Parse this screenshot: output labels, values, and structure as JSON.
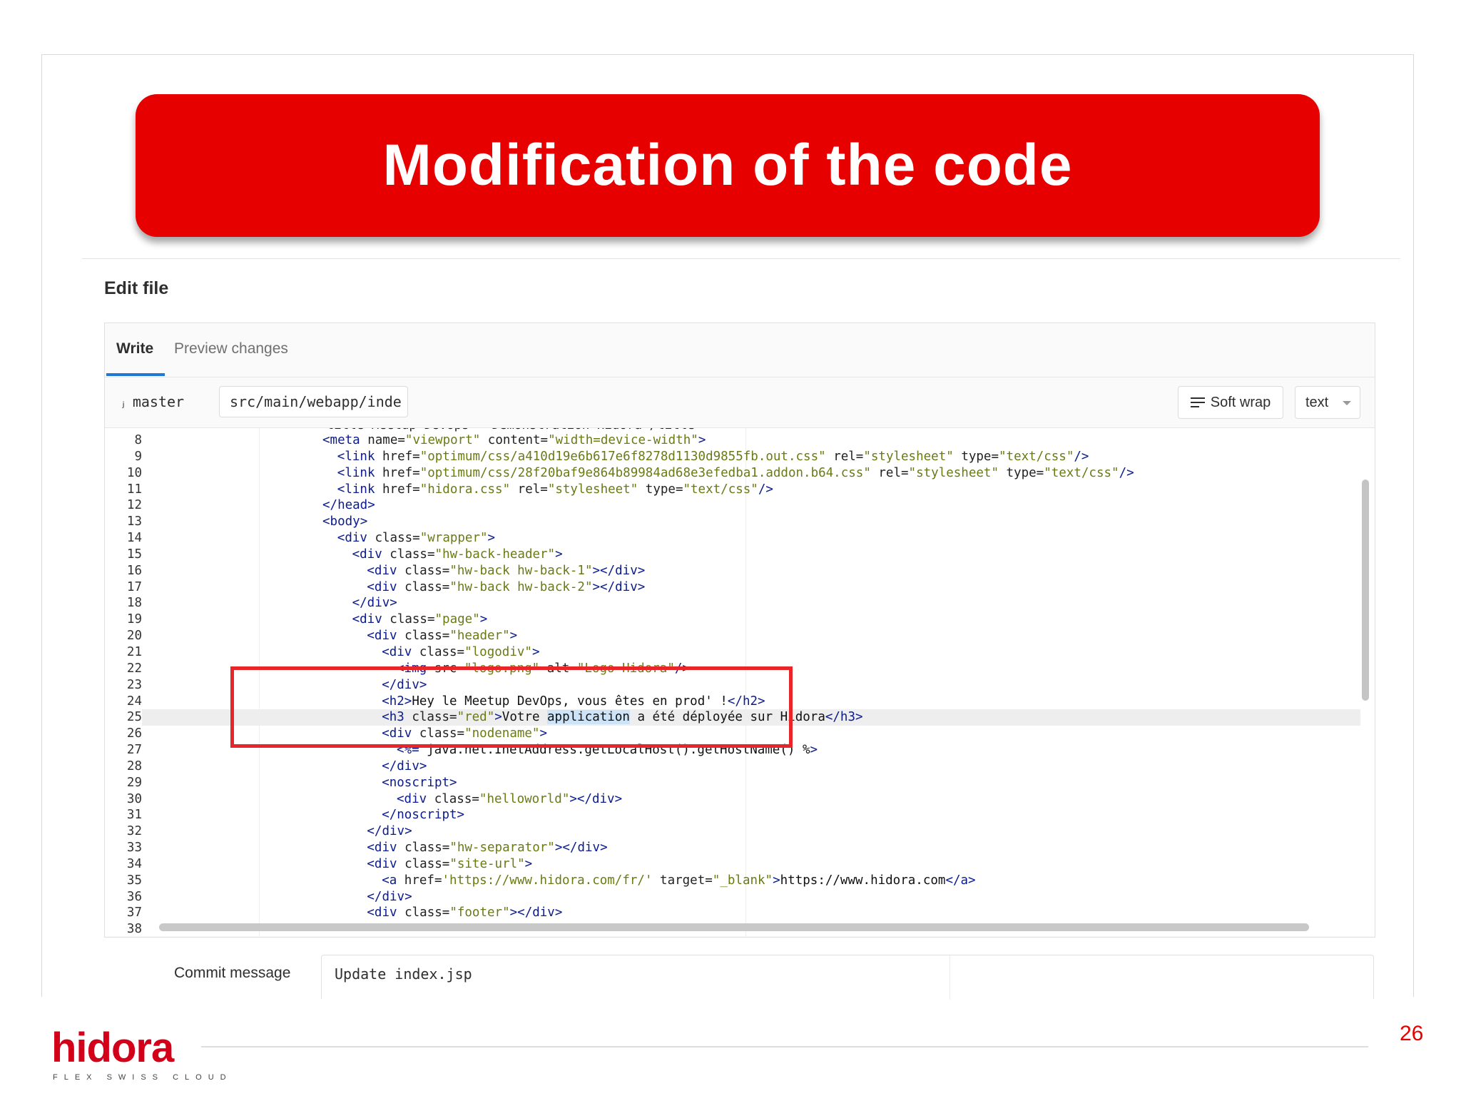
{
  "slide": {
    "title": "Modification of the code",
    "page_number": "26",
    "brand": {
      "name": "hidora",
      "tagline": "FLEX SWISS CLOUD",
      "color": "#d4001a"
    },
    "accent_color": "#e60000"
  },
  "editor": {
    "heading": "Edit file",
    "tabs": [
      {
        "label": "Write",
        "active": true
      },
      {
        "label": "Preview changes",
        "active": false
      }
    ],
    "branch": "master",
    "file_path": "src/main/webapp/inde",
    "soft_wrap_label": "Soft wrap",
    "mode_value": "text",
    "highlighted_lines": [
      22,
      26
    ],
    "active_line": 25,
    "selected_word": "application",
    "lines": [
      {
        "n": "8",
        "code": "<meta name=\"viewport\" content=\"width=device-width\">"
      },
      {
        "n": "9",
        "code": "<link href=\"optimum/css/a410d19e6b617e6f8278d1130d9855fb.out.css\" rel=\"stylesheet\" type=\"text/css\"/>"
      },
      {
        "n": "10",
        "code": "<link href=\"optimum/css/28f20baf9e864b89984ad68e3efedba1.addon.b64.css\" rel=\"stylesheet\" type=\"text/css\"/>"
      },
      {
        "n": "11",
        "code": "<link href=\"hidora.css\" rel=\"stylesheet\" type=\"text/css\"/>"
      },
      {
        "n": "12",
        "code": "</head>"
      },
      {
        "n": "13",
        "code": "<body>"
      },
      {
        "n": "14",
        "code": "<div class=\"wrapper\">"
      },
      {
        "n": "15",
        "code": "<div class=\"hw-back-header\">"
      },
      {
        "n": "16",
        "code": "<div class=\"hw-back hw-back-1\"></div>"
      },
      {
        "n": "17",
        "code": "<div class=\"hw-back hw-back-2\"></div>"
      },
      {
        "n": "18",
        "code": "</div>"
      },
      {
        "n": "19",
        "code": "<div class=\"page\">"
      },
      {
        "n": "20",
        "code": "<div class=\"header\">"
      },
      {
        "n": "21",
        "code": "<div class=\"logodiv\">"
      },
      {
        "n": "22",
        "code": "<img src=\"logo.png\" alt=\"Logo Hidora\"/>"
      },
      {
        "n": "23",
        "code": "</div>"
      },
      {
        "n": "24",
        "code": "<h2>Hey le Meetup DevOps, vous êtes en prod' !</h2>"
      },
      {
        "n": "25",
        "code": "<h3 class=\"red\">Votre application a été déployée sur Hidora</h3>"
      },
      {
        "n": "26",
        "code": "<div class=\"nodename\">"
      },
      {
        "n": "27",
        "code": "<%= java.net.InetAddress.getLocalHost().getHostName() %>"
      },
      {
        "n": "28",
        "code": "</div>"
      },
      {
        "n": "29",
        "code": "<noscript>"
      },
      {
        "n": "30",
        "code": "<div class=\"helloworld\"></div>"
      },
      {
        "n": "31",
        "code": "</noscript>"
      },
      {
        "n": "32",
        "code": "</div>"
      },
      {
        "n": "33",
        "code": "<div class=\"hw-separator\"></div>"
      },
      {
        "n": "34",
        "code": "<div class=\"site-url\">"
      },
      {
        "n": "35",
        "code": "<a href='https://www.hidora.com/fr/' target=\"_blank\">https://www.hidora.com</a>"
      },
      {
        "n": "36",
        "code": "</div>"
      },
      {
        "n": "37",
        "code": "<div class=\"footer\"></div>"
      },
      {
        "n": "38",
        "code": ""
      }
    ]
  },
  "commit": {
    "label": "Commit message",
    "value": "Update index.jsp"
  }
}
